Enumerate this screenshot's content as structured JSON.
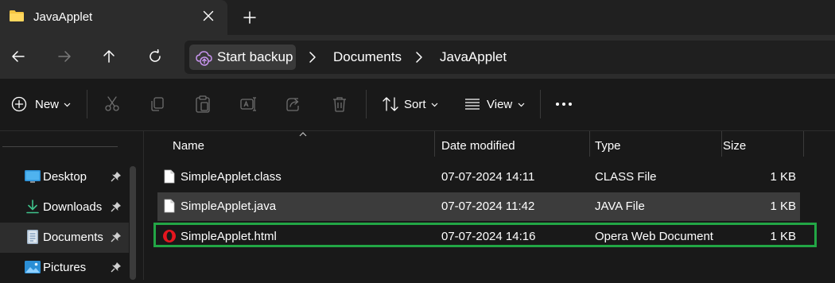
{
  "tab": {
    "title": "JavaApplet",
    "close_icon": "close-icon",
    "new_tab_icon": "plus-icon"
  },
  "nav": {
    "back_icon": "arrow-left-icon",
    "forward_icon": "arrow-right-icon",
    "up_icon": "arrow-up-icon",
    "refresh_icon": "refresh-icon"
  },
  "address": {
    "backup_label": "Start backup",
    "crumbs": [
      "Documents",
      "JavaApplet"
    ]
  },
  "commands": {
    "new_label": "New",
    "sort_label": "Sort",
    "view_label": "View",
    "icons": [
      "cut-icon",
      "copy-icon",
      "paste-icon",
      "rename-icon",
      "share-icon",
      "delete-icon",
      "more-icon"
    ]
  },
  "sidebar": {
    "items": [
      {
        "label": "Desktop",
        "icon": "desktop-icon",
        "pinned": true
      },
      {
        "label": "Downloads",
        "icon": "download-icon",
        "pinned": true
      },
      {
        "label": "Documents",
        "icon": "documents-icon",
        "pinned": true,
        "selected": true
      },
      {
        "label": "Pictures",
        "icon": "pictures-icon",
        "pinned": true
      }
    ]
  },
  "columns": {
    "name": "Name",
    "date": "Date modified",
    "type": "Type",
    "size": "Size"
  },
  "files": [
    {
      "name": "SimpleApplet.class",
      "date": "07-07-2024 14:11",
      "type": "CLASS File",
      "size": "1 KB",
      "icon": "file-icon"
    },
    {
      "name": "SimpleApplet.java",
      "date": "07-07-2024 11:42",
      "type": "JAVA File",
      "size": "1 KB",
      "icon": "file-icon"
    },
    {
      "name": "SimpleApplet.html",
      "date": "07-07-2024 14:16",
      "type": "Opera Web Document",
      "size": "1 KB",
      "icon": "opera-icon"
    }
  ],
  "colors": {
    "highlight": "#22a645",
    "accent_folder": "#f4c542",
    "backup_icon": "#c995f0"
  }
}
